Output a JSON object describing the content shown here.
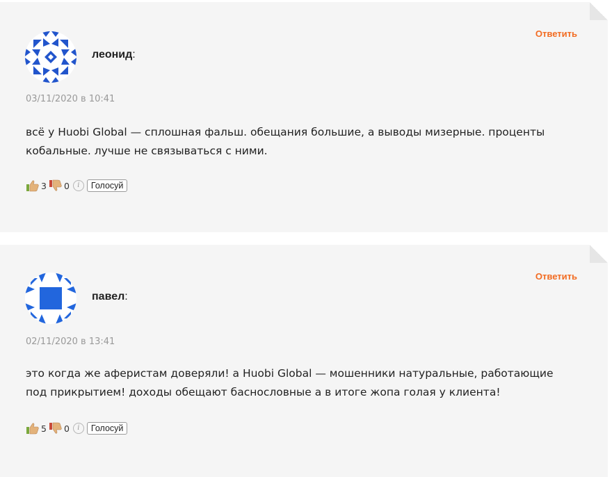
{
  "comments": [
    {
      "author": "леонид",
      "colon": ":",
      "reply_label": "Ответить",
      "date": "03/11/2020 в 10:41",
      "text_line1": "всё у Huobi Global — сплошная фальш. обещания большие, а выводы мизерные. проценты",
      "text_line2": "кобальные. лучше не связываться с ними.",
      "likes": "3",
      "dislikes": "0",
      "info_glyph": "i",
      "vote_label": "Голосуй",
      "avatar_color": "#2255cc"
    },
    {
      "author": "павел",
      "colon": ":",
      "reply_label": "Ответить",
      "date": "02/11/2020 в 13:41",
      "text_line1": "это когда же аферистам доверяли! а Huobi Global — мошенники натуральные, работающие",
      "text_line2": "под прикрытием! доходы обещают баснословные а в итоге жопа голая у клиента!",
      "likes": "5",
      "dislikes": "0",
      "info_glyph": "i",
      "vote_label": "Голосуй",
      "avatar_color": "#2266dd"
    }
  ],
  "colors": {
    "accent": "#f26b21",
    "card_bg": "#f5f5f5",
    "date": "#999999"
  }
}
